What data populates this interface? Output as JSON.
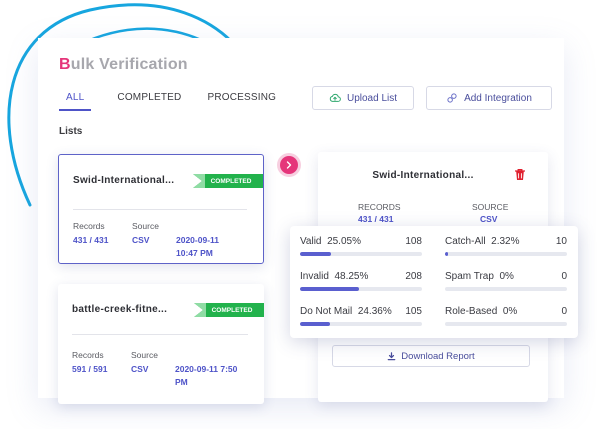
{
  "page": {
    "title_first": "B",
    "title_rest": "ulk Verification"
  },
  "tabs": [
    {
      "label": "ALL",
      "active": true
    },
    {
      "label": "COMPLETED",
      "active": false
    },
    {
      "label": "PROCESSING",
      "active": false
    }
  ],
  "actions": {
    "upload_label": "Upload List",
    "integration_label": "Add Integration"
  },
  "lists_label": "Lists",
  "lists": [
    {
      "name": "Swid-International...",
      "status": "COMPLETED",
      "records_label": "Records",
      "records": "431 / 431",
      "source_label": "Source",
      "source": "CSV",
      "date": "2020-09-11",
      "time": "10:47 PM"
    },
    {
      "name": "battle-creek-fitne...",
      "status": "COMPLETED",
      "records_label": "Records",
      "records": "591 / 591",
      "source_label": "Source",
      "source": "CSV",
      "date": "2020-09-11 7:50",
      "time": "PM"
    }
  ],
  "detail": {
    "name": "Swid-International...",
    "records_label": "RECORDS",
    "records": "431 / 431",
    "source_label": "SOURCE",
    "source": "CSV",
    "download_label": "Download Report"
  },
  "stats": [
    {
      "label": "Valid",
      "pct": "25.05%",
      "count": "108",
      "fraction": 0.2505
    },
    {
      "label": "Catch-All",
      "pct": "2.32%",
      "count": "10",
      "fraction": 0.0232
    },
    {
      "label": "Invalid",
      "pct": "48.25%",
      "count": "208",
      "fraction": 0.4825
    },
    {
      "label": "Spam Trap",
      "pct": "0%",
      "count": "0",
      "fraction": 0
    },
    {
      "label": "Do Not Mail",
      "pct": "24.36%",
      "count": "105",
      "fraction": 0.2436
    },
    {
      "label": "Role-Based",
      "pct": "0%",
      "count": "0",
      "fraction": 0
    }
  ],
  "colors": {
    "accent": "#4e53c8",
    "brand_pink": "#e5357a",
    "success": "#22b24c",
    "deco_blue": "#1aa9e0"
  },
  "icons": [
    "cloud-upload-icon",
    "integration-icon",
    "arrow-right-icon",
    "trash-icon",
    "download-icon"
  ]
}
